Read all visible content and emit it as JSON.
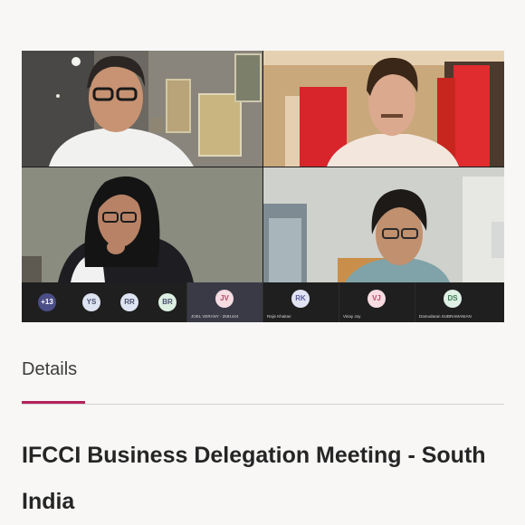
{
  "details_tab": {
    "label": "Details"
  },
  "meeting": {
    "title": "IFCCI Business Delegation Meeting - South India"
  },
  "participant_strip": {
    "overflow_count": "+13",
    "small_avatars": [
      {
        "initials": "YS",
        "color": "#dde3f0"
      },
      {
        "initials": "RR",
        "color": "#dfe4f2"
      },
      {
        "initials": "BR",
        "color": "#dcefe1"
      }
    ],
    "named_avatars": [
      {
        "initials": "JV",
        "name": "JOEL VERANY - 2591444",
        "color": "#f6dde3",
        "text_color": "#b94a67",
        "selected": true
      },
      {
        "initials": "RK",
        "name": "Rajiv Khaitan",
        "color": "#e1e3f3",
        "text_color": "#5a5f9a",
        "selected": false
      },
      {
        "initials": "VJ",
        "name": "Vinay Joy",
        "color": "#f7dde3",
        "text_color": "#bf4b6a",
        "selected": false
      },
      {
        "initials": "DS",
        "name": "Damodaran SUBRAMANIAN",
        "color": "#dff0e5",
        "text_color": "#3f7d57",
        "selected": false
      }
    ]
  }
}
